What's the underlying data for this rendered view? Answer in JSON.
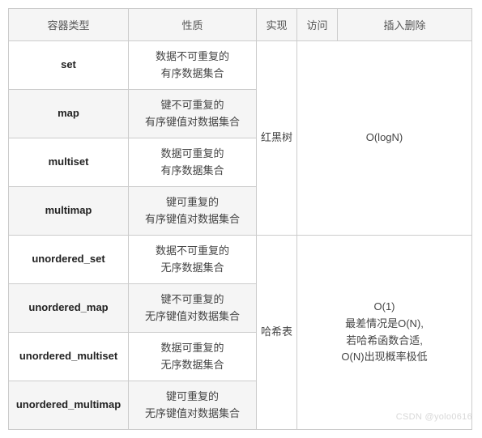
{
  "headers": {
    "name": "容器类型",
    "prop": "性质",
    "impl": "实现",
    "acc": "访问",
    "ins": "插入删除"
  },
  "groups": [
    {
      "impl": "红黑树",
      "acc_ins": "O(logN)",
      "rows": [
        {
          "name": "set",
          "prop1": "数据不可重复的",
          "prop2": "有序数据集合"
        },
        {
          "name": "map",
          "prop1": "键不可重复的",
          "prop2": "有序键值对数据集合"
        },
        {
          "name": "multiset",
          "prop1": "数据可重复的",
          "prop2": "有序数据集合"
        },
        {
          "name": "multimap",
          "prop1": "键可重复的",
          "prop2": "有序键值对数据集合"
        }
      ]
    },
    {
      "impl": "哈希表",
      "acc_ins_lines": [
        "O(1)",
        "最差情况是O(N),",
        "若哈希函数合适,",
        "O(N)出现概率极低"
      ],
      "rows": [
        {
          "name": "unordered_set",
          "prop1": "数据不可重复的",
          "prop2": "无序数据集合"
        },
        {
          "name": "unordered_map",
          "prop1": "键不可重复的",
          "prop2": "无序键值对数据集合"
        },
        {
          "name": "unordered_multiset",
          "prop1": "数据可重复的",
          "prop2": "无序数据集合"
        },
        {
          "name": "unordered_multimap",
          "prop1": "键可重复的",
          "prop2": "无序键值对数据集合"
        }
      ]
    }
  ],
  "watermark": "CSDN @yolo0616"
}
